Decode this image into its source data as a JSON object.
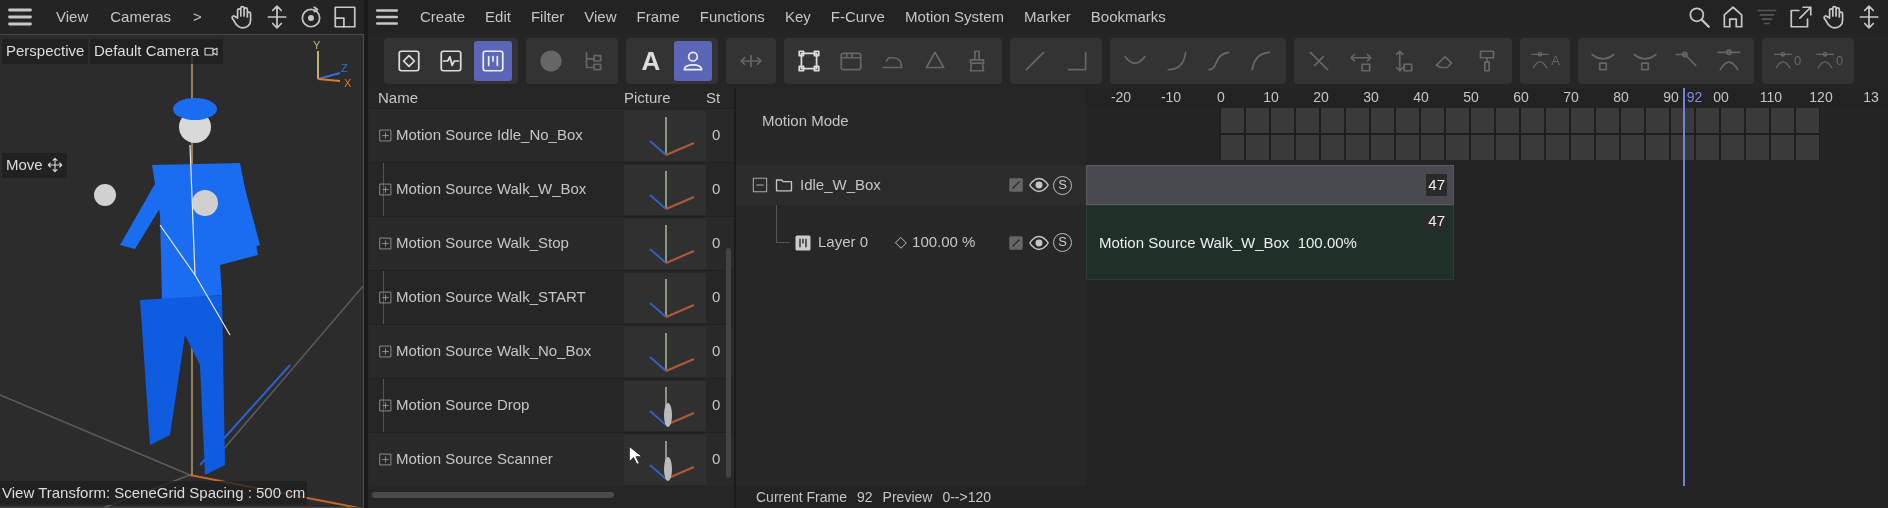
{
  "viewport": {
    "menu": [
      "View",
      "Cameras",
      ">"
    ],
    "projection": "Perspective",
    "camera": "Default Camera",
    "axes": [
      "Y",
      "Z",
      "X"
    ],
    "tool": "Move",
    "view_transform": "View Transform: Scene",
    "grid_spacing": "Grid Spacing : 500 cm"
  },
  "menubar": [
    "Create",
    "Edit",
    "Filter",
    "View",
    "Frame",
    "Functions",
    "Key",
    "F-Curve",
    "Motion System",
    "Marker",
    "Bookmarks"
  ],
  "toolbar": [
    {
      "items": [
        {
          "selected": false,
          "disabled": false
        },
        {
          "selected": false,
          "disabled": false
        },
        {
          "selected": true,
          "disabled": false
        }
      ]
    },
    {
      "items": [
        {
          "selected": false,
          "disabled": true
        },
        {
          "selected": false,
          "disabled": true
        }
      ]
    },
    {
      "items": [
        {
          "label": "A",
          "selected": false,
          "disabled": false
        },
        {
          "selected": true,
          "disabled": false
        }
      ]
    },
    {
      "items": [
        {
          "selected": false,
          "disabled": true
        }
      ]
    },
    {
      "items": [
        {
          "selected": false,
          "disabled": false
        },
        {
          "selected": false,
          "disabled": true
        },
        {
          "selected": false,
          "disabled": true
        },
        {
          "selected": false,
          "disabled": true
        },
        {
          "selected": false,
          "disabled": true
        }
      ]
    },
    {
      "items": [
        {
          "selected": false,
          "disabled": true
        },
        {
          "selected": false,
          "disabled": true
        }
      ]
    },
    {
      "items": [
        {
          "selected": false,
          "disabled": true
        },
        {
          "selected": false,
          "disabled": true
        },
        {
          "selected": false,
          "disabled": true
        },
        {
          "selected": false,
          "disabled": true
        }
      ]
    },
    {
      "items": [
        {
          "selected": false,
          "disabled": true
        },
        {
          "selected": false,
          "disabled": true
        },
        {
          "selected": false,
          "disabled": true
        },
        {
          "selected": false,
          "disabled": true
        },
        {
          "selected": false,
          "disabled": true
        }
      ]
    },
    {
      "items": [
        {
          "label": "A",
          "selected": false,
          "disabled": true
        }
      ]
    },
    {
      "items": [
        {
          "selected": false,
          "disabled": true
        },
        {
          "selected": false,
          "disabled": true
        },
        {
          "selected": false,
          "disabled": true
        },
        {
          "selected": false,
          "disabled": true
        }
      ]
    },
    {
      "items": [
        {
          "label": "0",
          "selected": false,
          "disabled": true
        },
        {
          "label": "0",
          "selected": false,
          "disabled": true
        }
      ]
    }
  ],
  "library": {
    "columns": [
      "Name",
      "Picture",
      "St"
    ],
    "rows": [
      {
        "name": "Motion Source Idle_No_Box",
        "status": "0"
      },
      {
        "name": "Motion Source Walk_W_Box",
        "status": "0"
      },
      {
        "name": "Motion Source Walk_Stop",
        "status": "0"
      },
      {
        "name": "Motion Source Walk_START",
        "status": "0"
      },
      {
        "name": "Motion Source Walk_No_Box",
        "status": "0"
      },
      {
        "name": "Motion Source Drop",
        "status": "0"
      },
      {
        "name": "Motion Source Scanner",
        "status": "0"
      }
    ]
  },
  "timeline": {
    "mode_label": "Motion Mode",
    "ruler": [
      "-20",
      "-10",
      "0",
      "10",
      "20",
      "30",
      "40",
      "50",
      "60",
      "70",
      "80",
      "90",
      "00",
      "110",
      "120",
      "13"
    ],
    "playhead": {
      "label": "92",
      "level": 0.744
    },
    "tracks": [
      {
        "kind": "group",
        "name": "Idle_W_Box",
        "expanded": true,
        "solo": "S",
        "clip": {
          "end": "47"
        },
        "children": [
          {
            "kind": "layer",
            "name": "Layer 0",
            "weight": "100.00 %",
            "solo": "S",
            "clip": {
              "end": "47",
              "label": "Motion Source Walk_W_Box  100.00%"
            }
          }
        ]
      }
    ]
  },
  "status_bar": [
    "Current Frame",
    "92",
    "Preview",
    "0-->120"
  ]
}
